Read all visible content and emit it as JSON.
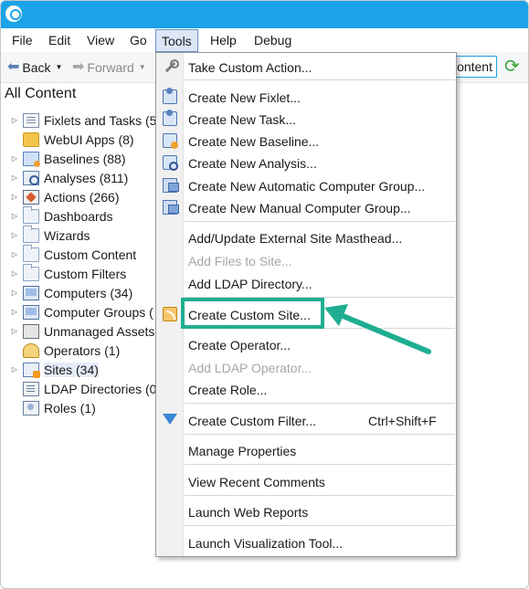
{
  "menubar": {
    "items": [
      "File",
      "Edit",
      "View",
      "Go",
      "Tools",
      "Help",
      "Debug"
    ],
    "active": "Tools"
  },
  "toolbar": {
    "back_label": "Back",
    "forward_label": "Forward",
    "content_label": "Content",
    "content_visible_label": "ontent"
  },
  "section_title": "All Content",
  "tree": [
    {
      "label": "Fixlets and Tasks (5",
      "expandable": true,
      "icon": "fixlets-icon"
    },
    {
      "label": "WebUI Apps (8)",
      "expandable": false,
      "icon": "webui-icon"
    },
    {
      "label": "Baselines (88)",
      "expandable": true,
      "icon": "baseline-icon"
    },
    {
      "label": "Analyses (811)",
      "expandable": true,
      "icon": "analysis-icon"
    },
    {
      "label": "Actions (266)",
      "expandable": true,
      "icon": "action-icon"
    },
    {
      "label": "Dashboards",
      "expandable": true,
      "icon": "folder-icon"
    },
    {
      "label": "Wizards",
      "expandable": true,
      "icon": "folder-icon"
    },
    {
      "label": "Custom Content",
      "expandable": true,
      "icon": "folder-icon"
    },
    {
      "label": "Custom Filters",
      "expandable": true,
      "icon": "folder-icon"
    },
    {
      "label": "Computers (34)",
      "expandable": true,
      "icon": "computer-icon"
    },
    {
      "label": "Computer Groups (",
      "expandable": true,
      "icon": "computer-group-icon"
    },
    {
      "label": "Unmanaged Assets",
      "expandable": true,
      "icon": "unmanaged-icon"
    },
    {
      "label": "Operators (1)",
      "expandable": false,
      "icon": "operator-icon"
    },
    {
      "label": "Sites (34)",
      "expandable": true,
      "icon": "sites-icon",
      "selected": true
    },
    {
      "label": "LDAP Directories (0",
      "expandable": false,
      "icon": "ldap-icon"
    },
    {
      "label": "Roles (1)",
      "expandable": false,
      "icon": "roles-icon"
    }
  ],
  "tools_menu": {
    "take_custom_action": "Take Custom Action...",
    "create_new_fixlet": "Create New Fixlet...",
    "create_new_task": "Create New Task...",
    "create_new_baseline": "Create New Baseline...",
    "create_new_analysis": "Create New Analysis...",
    "create_new_automatic_group": "Create New Automatic Computer Group...",
    "create_new_manual_group": "Create New Manual Computer Group...",
    "add_update_masthead": "Add/Update External Site Masthead...",
    "add_files_to_site": "Add Files to Site...",
    "add_ldap_directory": "Add LDAP Directory...",
    "create_custom_site": "Create Custom Site...",
    "create_operator": "Create Operator...",
    "add_ldap_operator": "Add LDAP Operator...",
    "create_role": "Create Role...",
    "create_custom_filter": "Create Custom Filter...",
    "create_custom_filter_shortcut": "Ctrl+Shift+F",
    "manage_properties": "Manage Properties",
    "view_recent_comments": "View Recent Comments",
    "launch_web_reports": "Launch Web Reports",
    "launch_visualization_tool": "Launch Visualization Tool..."
  },
  "colors": {
    "titlebar": "#1aa3e8",
    "highlight": "#1fae92",
    "menu_active": "#dbe7f7"
  }
}
